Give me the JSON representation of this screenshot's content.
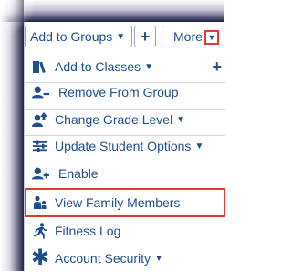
{
  "toolbar": {
    "add_to_groups": "Add to Groups",
    "add_label": "+",
    "more": "More"
  },
  "menu": {
    "items": [
      {
        "label": "Add to Classes",
        "icon": "books-icon",
        "has_caret": true
      },
      {
        "label": "Remove From Group",
        "icon": "user-minus-icon",
        "has_caret": false
      },
      {
        "label": "Change Grade Level",
        "icon": "users-up-icon",
        "has_caret": true
      },
      {
        "label": "Update Student Options",
        "icon": "sliders-icon",
        "has_caret": true
      },
      {
        "label": "Enable",
        "icon": "user-plus-icon",
        "has_caret": false
      },
      {
        "label": "View Family Members",
        "icon": "family-icon",
        "has_caret": false
      },
      {
        "label": "Fitness Log",
        "icon": "running-icon",
        "has_caret": false
      },
      {
        "label": "Account Security",
        "icon": "asterisk-icon",
        "has_caret": true
      }
    ],
    "side_plus": "+"
  },
  "colors": {
    "accent": "#1f4e8c",
    "highlight": "#e03c31",
    "border": "#9aa8bc"
  }
}
